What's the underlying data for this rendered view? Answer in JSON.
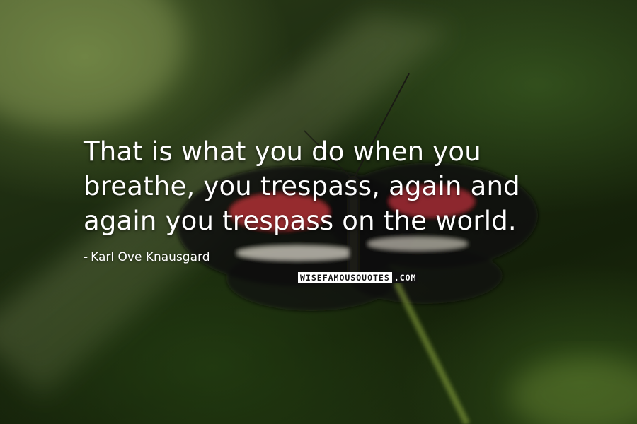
{
  "quote": {
    "lines": [
      "That is what you do when you",
      "breathe, you trespass, again and",
      "again you trespass on the world."
    ]
  },
  "author": {
    "prefix": "-",
    "name": "Karl Ove Knausgard"
  },
  "watermark": {
    "main": "WISEFAMOUSQUOTES",
    "suffix": ".COM"
  },
  "colors": {
    "text": "#ffffff",
    "background": "#1b2a0f"
  }
}
